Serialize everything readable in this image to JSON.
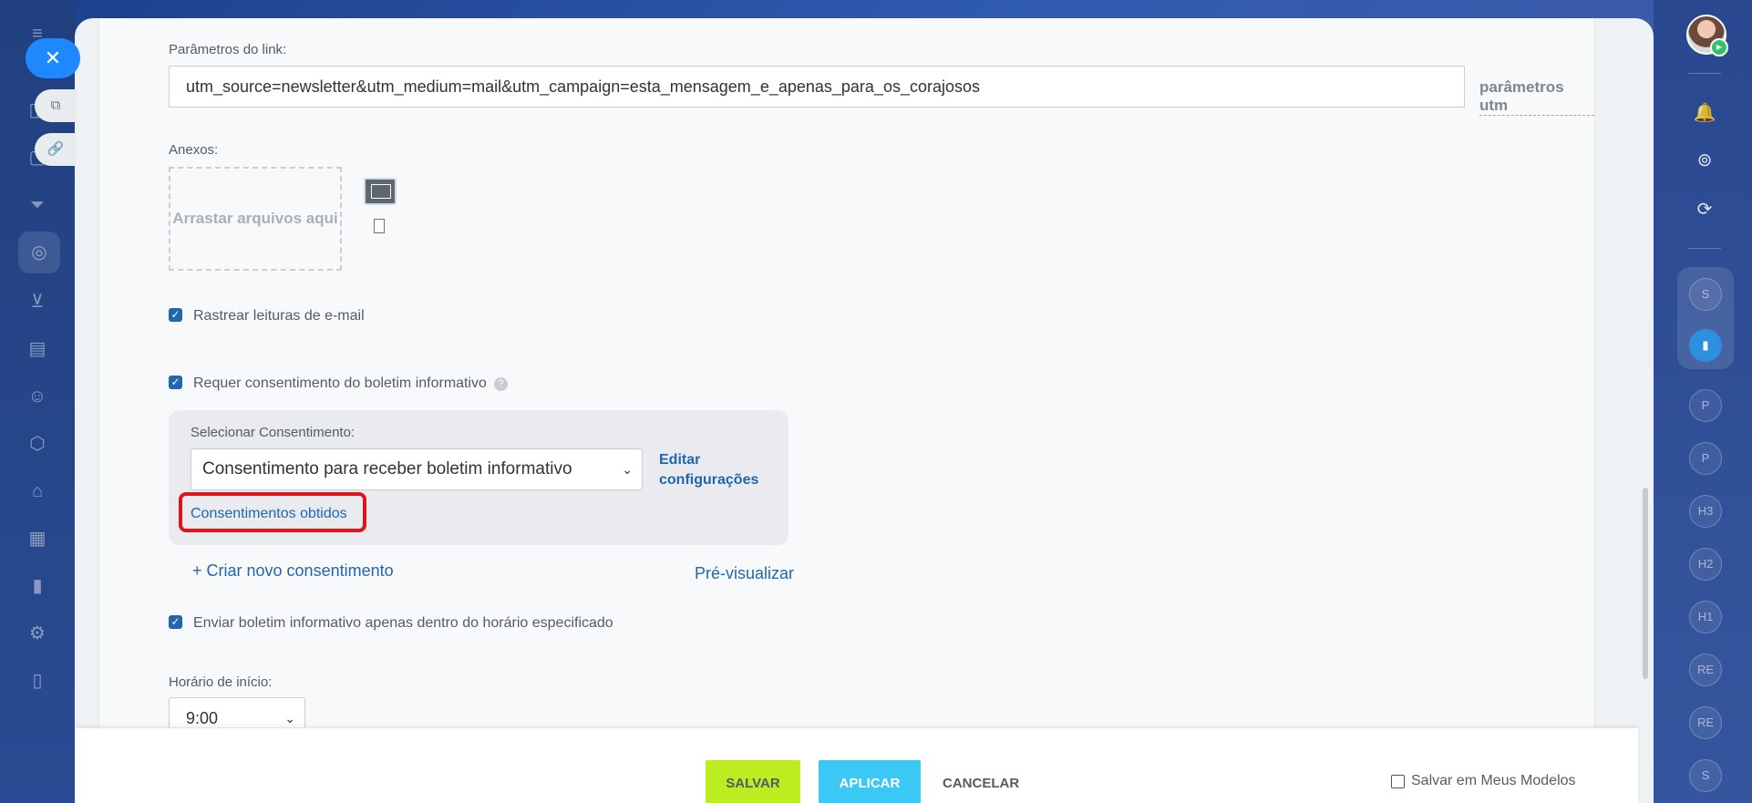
{
  "left_rail": {
    "close_icon": "close-icon",
    "items": [
      "external-link-icon",
      "link-icon",
      "funnel-icon",
      "target-icon",
      "cart-icon",
      "id-card-icon",
      "robot-icon",
      "box-icon",
      "warehouse-icon",
      "calendar-icon",
      "chart-icon",
      "settings-icon",
      "document-icon"
    ]
  },
  "right_rail": {
    "badges": [
      "S",
      "P",
      "P",
      "H3",
      "H2",
      "H1",
      "RE",
      "RE",
      "S"
    ]
  },
  "link_params": {
    "label": "Parâmetros do link:",
    "value": "utm_source=newsletter&utm_medium=mail&utm_campaign=esta_mensagem_e_apenas_para_os_corajosos",
    "utm_link": "parâmetros utm"
  },
  "attachments": {
    "label": "Anexos:",
    "dropzone": "Arrastar arquivos aqui"
  },
  "options": {
    "track_reads": "Rastrear leituras de e-mail",
    "require_consent": "Requer consentimento do boletim informativo",
    "send_within_hours": "Enviar boletim informativo apenas dentro do horário especificado"
  },
  "consent": {
    "select_label": "Selecionar Consentimento:",
    "selected": "Consentimento para receber boletim informativo",
    "edit_link": "Editar configurações",
    "obtained_link": "Consentimentos obtidos",
    "create_link": "+ Criar novo consentimento",
    "preview_link": "Pré-visualizar"
  },
  "start_time": {
    "label": "Horário de início:",
    "value": "9:00"
  },
  "footer": {
    "save": "SALVAR",
    "apply": "APLICAR",
    "cancel": "CANCELAR",
    "save_template": "Salvar em Meus Modelos"
  },
  "colors": {
    "accent": "#2067b0",
    "save_button": "#bbed21",
    "apply_button": "#3bc8f5",
    "highlight": "#e0141c"
  }
}
